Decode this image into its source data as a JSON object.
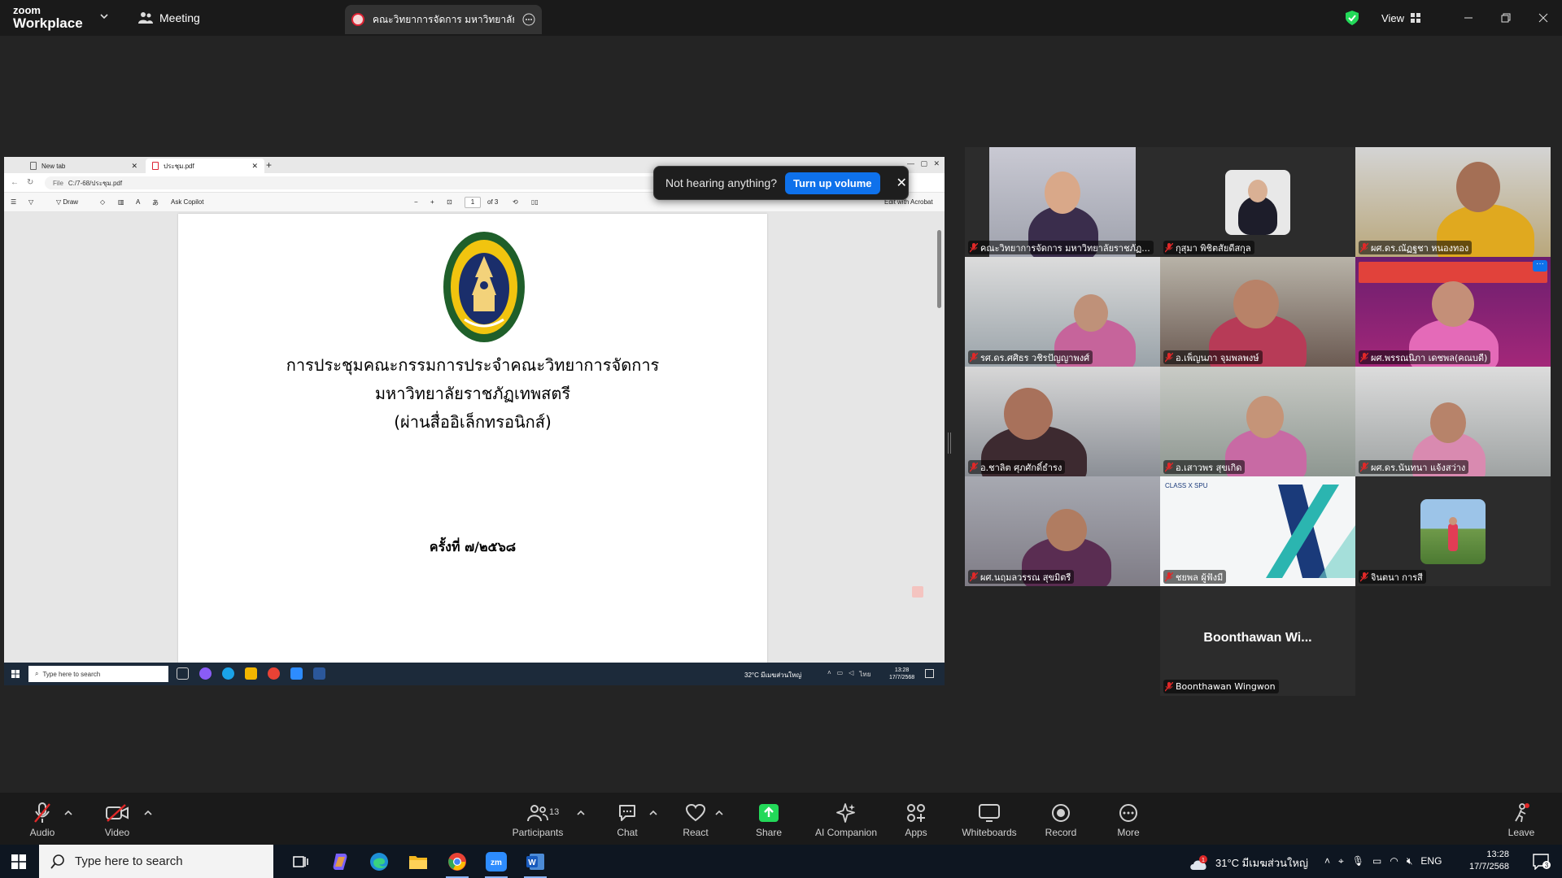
{
  "app": {
    "brand_top": "zoom",
    "brand_bottom": "Workplace",
    "meeting_label": "Meeting",
    "share_tab_title": "คณะวิทยาการจัดการ มหาวิทยาลัยราชภัฏ",
    "view_label": "View"
  },
  "shared_screen": {
    "tabs": [
      {
        "label": "New tab"
      },
      {
        "label": "ประชุม.pdf"
      }
    ],
    "address": {
      "prefix": "File",
      "url": "C:/7-68/ประชุม.pdf"
    },
    "pdf_toolbar": {
      "draw_label": "Draw",
      "copilot_label": "Ask Copilot",
      "page_current": "1",
      "page_total": "of 3",
      "acrobat_label": "Edit with Acrobat"
    },
    "document": {
      "line1": "การประชุมคณะกรรมการประจำคณะวิทยาการจัดการ",
      "line2": "มหาวิทยาลัยราชภัฏเทพสตรี",
      "line3": "(ผ่านสื่ออิเล็กทรอนิกส์)",
      "session": "ครั้งที่ ๗/๒๕๖๘"
    },
    "remote_taskbar": {
      "search_placeholder": "Type here to search",
      "weather": "32°C มีเมฆส่วนใหญ่",
      "lang": "ไทย",
      "time": "13:28",
      "date": "17/7/2568"
    }
  },
  "volume_toast": {
    "message": "Not hearing anything?",
    "button": "Turn up volume"
  },
  "gallery": {
    "participants": [
      {
        "name": "คณะวิทยาการจัดการ มหาวิทยาลัยราชภัฏ..."
      },
      {
        "name": "กุสุมา พิชิตสัยดีสกุล"
      },
      {
        "name": "ผศ.ดร.ณัฏฐชา หนองทอง"
      },
      {
        "name": "รศ.ดร.ศศิธร วชิรปัญญาพงศ์"
      },
      {
        "name": "อ.เพ็ญนภา จุมพลพงษ์"
      },
      {
        "name": "ผศ.พรรณนิภา เดชพล(คณบดี)"
      },
      {
        "name": "อ.ชาลิต ศุภศักดิ์ธำรง"
      },
      {
        "name": "อ.เสาวพร สุขเกิด"
      },
      {
        "name": "ผศ.ดร.นันทนา แจ้งสว่าง"
      },
      {
        "name": "ผศ.นฤมลวรรณ สุขมิตรี"
      },
      {
        "name": "ชยพล ผู้ฟังมี"
      },
      {
        "name": "จินตนา การสี"
      },
      {
        "name": "Boonthawan Wingwon",
        "display": "Boonthawan Wi..."
      }
    ]
  },
  "toolbar": {
    "audio": "Audio",
    "video": "Video",
    "participants": "Participants",
    "participant_count": "13",
    "chat": "Chat",
    "react": "React",
    "share": "Share",
    "ai_companion": "AI Companion",
    "apps": "Apps",
    "whiteboards": "Whiteboards",
    "record": "Record",
    "more": "More",
    "leave": "Leave"
  },
  "taskbar": {
    "search_placeholder": "Type here to search",
    "weather": "31°C มีเมฆส่วนใหญ่",
    "weather_badge": "1",
    "lang": "ENG",
    "time": "13:28",
    "date": "17/7/2568",
    "notif_count": "3"
  },
  "colors": {
    "zoom_blue": "#0e71eb",
    "active_speaker": "#23d959",
    "share_green": "#23d959",
    "mute_red": "#e02828"
  }
}
